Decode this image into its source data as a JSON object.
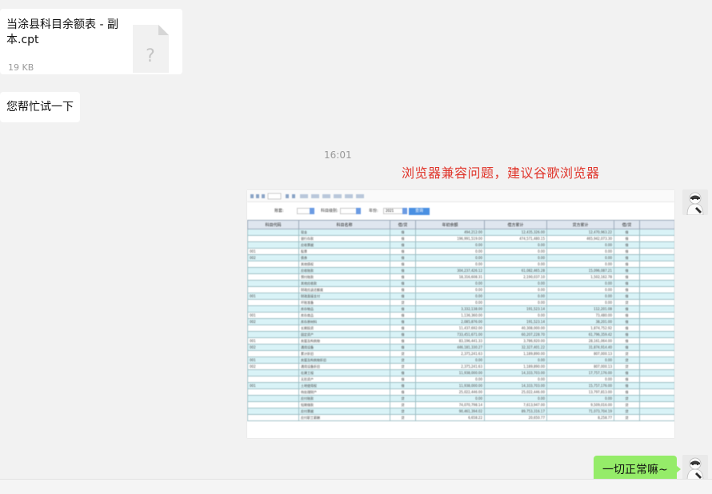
{
  "file_message": {
    "name": "当涂县科目余额表 - 副本.cpt",
    "size": "19 KB",
    "icon": "unknown-file-icon"
  },
  "left_text_message": "您帮忙试一下",
  "timestamp": "16:01",
  "annotation_note": "浏览器兼容问题，建议谷歌浏览器",
  "screenshot": {
    "filter_labels": [
      "账套:",
      "科目级别:",
      "年份:"
    ],
    "year_value": "2021",
    "query_button": "查询",
    "columns": [
      "科目代码",
      "科目名称",
      "借/贷",
      "年初余额",
      "借方累计",
      "贷方累计",
      "借/贷"
    ],
    "rows": [
      [
        "",
        "现金",
        "借",
        "494,212.00",
        "12,435,326.00",
        "12,470,963.22",
        "借"
      ],
      [
        "",
        "银行存款",
        "借",
        "196,991,519.00",
        "474,571,480.15",
        "465,942,073.30",
        "借"
      ],
      [
        "",
        "应收票据",
        "借",
        "0.00",
        "0.00",
        "0.00",
        "借"
      ],
      [
        "001",
        "股票",
        "借",
        "0.00",
        "0.00",
        "0.00",
        "借"
      ],
      [
        "002",
        "债券",
        "借",
        "0.00",
        "0.00",
        "0.00",
        "借"
      ],
      [
        "",
        "其他债权",
        "借",
        "0.00",
        "0.00",
        "0.00",
        "借"
      ],
      [
        "",
        "应收账款",
        "借",
        "304,237,426.12",
        "61,082,465.28",
        "15,096,087.21",
        "借"
      ],
      [
        "",
        "预付账款",
        "借",
        "18,316,608.31",
        "2,190,037.10",
        "1,502,162.78",
        "借"
      ],
      [
        "",
        "其他应收款",
        "借",
        "0.00",
        "0.00",
        "0.00",
        "借"
      ],
      [
        "",
        "财政应返还额度",
        "借",
        "0.00",
        "0.00",
        "0.00",
        "借"
      ],
      [
        "001",
        "财政直接支付",
        "借",
        "0.00",
        "0.00",
        "0.00",
        "借"
      ],
      [
        "",
        "坏账准备",
        "贷",
        "0.00",
        "0.00",
        "0.00",
        "贷"
      ],
      [
        "",
        "库存物品",
        "借",
        "3,332,138.00",
        "191,523.14",
        "112,201.08",
        "借"
      ],
      [
        "001",
        "库存商品",
        "借",
        "1,136,360.00",
        "0.00",
        "73,480.00",
        "借"
      ],
      [
        "002",
        "库存原材料",
        "借",
        "2,085,876.00",
        "191,523.14",
        "38,201.00",
        "借"
      ],
      [
        "",
        "长期投资",
        "借",
        "11,437,692.00",
        "40,308,000.00",
        "1,874,752.92",
        "借"
      ],
      [
        "",
        "固定资产",
        "借",
        "733,451,671.00",
        "60,207,228.70",
        "61,796,359.42",
        "借"
      ],
      [
        "001",
        "房屋及构筑物",
        "借",
        "83,196,441.33",
        "3,786,920.00",
        "28,161,064.00",
        "借"
      ],
      [
        "002",
        "通用设备",
        "借",
        "446,181,330.27",
        "32,327,401.22",
        "31,874,914.40",
        "借"
      ],
      [
        "",
        "累计折旧",
        "贷",
        "2,375,241.63",
        "1,189,890.00",
        "807,000.13",
        "贷"
      ],
      [
        "001",
        "房屋及构筑物折旧",
        "贷",
        "0.00",
        "0.00",
        "0.00",
        "贷"
      ],
      [
        "002",
        "通用设备折旧",
        "贷",
        "2,375,241.63",
        "1,189,890.00",
        "807,000.13",
        "贷"
      ],
      [
        "",
        "在建工程",
        "借",
        "11,938,000.00",
        "14,333,703.00",
        "17,757,176.00",
        "借"
      ],
      [
        "",
        "无形资产",
        "借",
        "0.00",
        "0.00",
        "0.00",
        "借"
      ],
      [
        "001",
        "土地使用权",
        "借",
        "11,938,000.00",
        "14,333,703.00",
        "15,757,176.00",
        "借"
      ],
      [
        "",
        "待处理财产",
        "借",
        "25,022,446.00",
        "25,022,446.00",
        "13,797,813.00",
        "借"
      ],
      [
        "",
        "应付账款",
        "贷",
        "0.00",
        "0.00",
        "0.00",
        "贷"
      ],
      [
        "",
        "短期借款",
        "贷",
        "74,070,798.14",
        "7,613,947.00",
        "9,509,016.00",
        "贷"
      ],
      [
        "",
        "应付票据",
        "贷",
        "90,461,394.02",
        "89,753,316.17",
        "71,073,704.19",
        "贷"
      ],
      [
        "",
        "应付职工薪酬",
        "贷",
        "6,658.22",
        "20,650.77",
        "8,258.77",
        "贷"
      ]
    ]
  },
  "right_text_message": "一切正常嘛~",
  "avatar_icon": "robot-avatar-icon"
}
